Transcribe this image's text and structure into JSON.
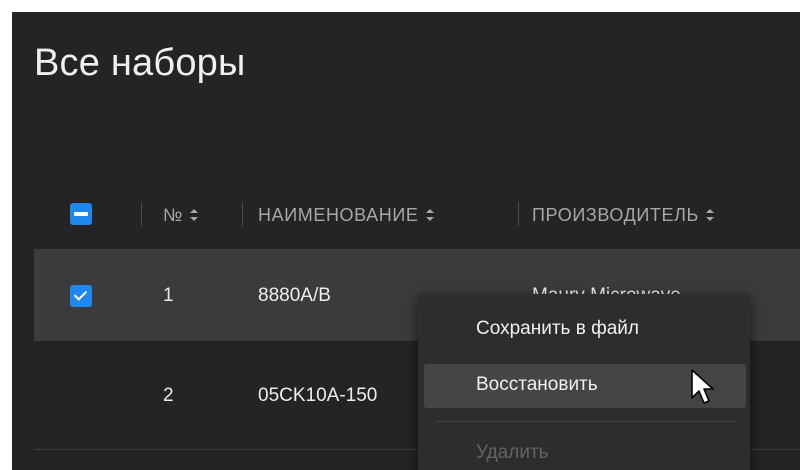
{
  "page": {
    "title": "Все наборы"
  },
  "table": {
    "columns": [
      {
        "label": "№"
      },
      {
        "label": "НАИМЕНОВАНИЕ"
      },
      {
        "label": "ПРОИЗВОДИТЕЛЬ"
      }
    ],
    "header_checkbox_state": "indeterminate",
    "rows": [
      {
        "selected": true,
        "number": "1",
        "name": "8880A/B",
        "manufacturer": "Maury Microwave"
      },
      {
        "selected": false,
        "number": "2",
        "name": "05CK10A-150",
        "manufacturer": ""
      }
    ]
  },
  "context_menu": {
    "items": [
      {
        "label": "Сохранить в файл",
        "state": "normal"
      },
      {
        "label": "Восстановить",
        "state": "hover"
      },
      {
        "label": "Удалить",
        "state": "disabled"
      }
    ]
  },
  "colors": {
    "background": "#242424",
    "selected_row": "#3b3b3b",
    "accent": "#1e88f0",
    "menu_background": "#2d2d2d",
    "menu_hover": "#454545"
  }
}
